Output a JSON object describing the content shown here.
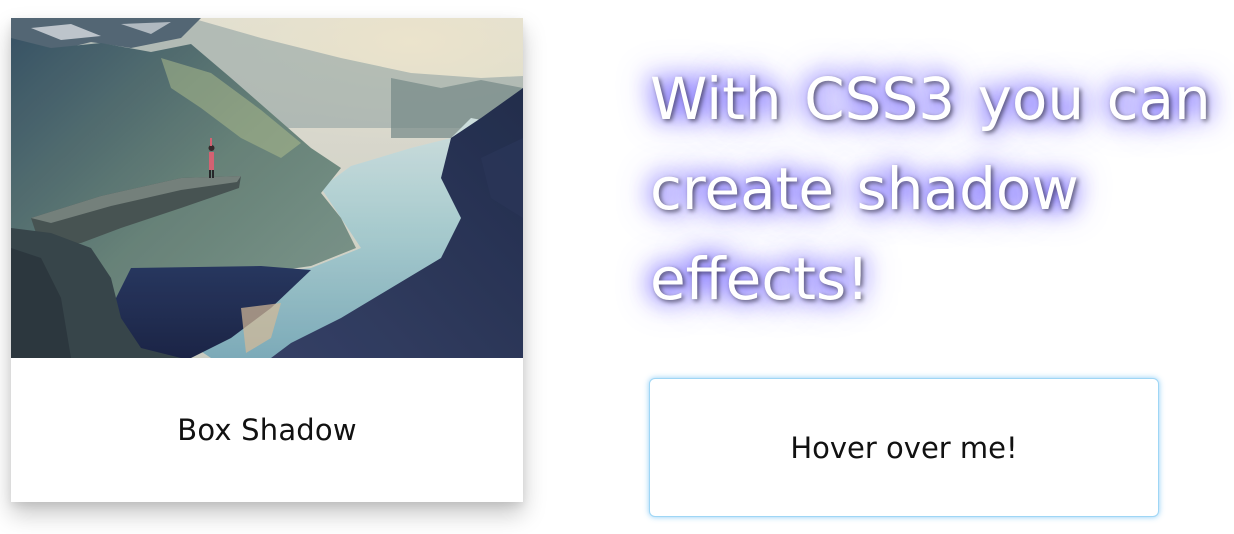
{
  "card": {
    "image": {
      "subject": "person standing on cliff overlooking fjord",
      "icon": "landscape-photo"
    },
    "caption": "Box Shadow"
  },
  "heading": {
    "lines": [
      "With CSS3 you can",
      "create shadow",
      "effects!"
    ],
    "text_color": "#ffffff",
    "glow_color": "#4632ff"
  },
  "hover_button": {
    "label": "Hover over me!",
    "border_color": "#9fd6f5"
  }
}
